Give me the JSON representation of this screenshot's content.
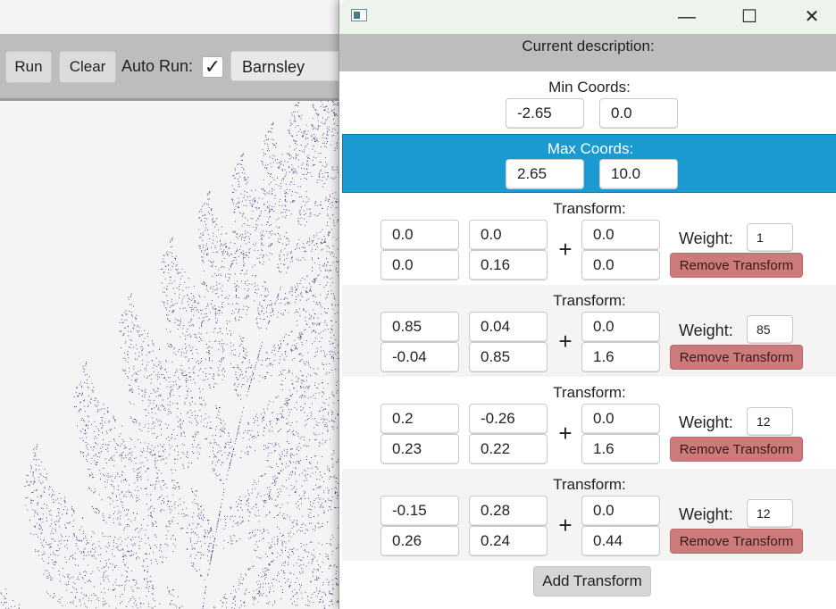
{
  "main_window": {
    "toolbar": {
      "run_label": "Run",
      "clear_label": "Clear",
      "auto_run_label": "Auto Run:",
      "auto_run_checked_glyph": "✓",
      "fractal_selected": "Barnsley"
    },
    "fractal_color": "#2f2a7a"
  },
  "popup": {
    "title_icon": "app-icon",
    "window_controls": {
      "minimize": "—",
      "maximize": "☐",
      "close": "✕"
    },
    "current_description_label": "Current description:",
    "min_coords": {
      "label": "Min Coords:",
      "x": "-2.65",
      "y": "0.0"
    },
    "max_coords": {
      "label": "Max Coords:",
      "x": "2.65",
      "y": "10.0"
    },
    "transform_label": "Transform:",
    "weight_label": "Weight:",
    "remove_label": "Remove Transform",
    "plus_sign": "+",
    "transforms": [
      {
        "a": "0.0",
        "b": "0.0",
        "c": "0.0",
        "d": "0.16",
        "e": "0.0",
        "f": "0.0",
        "weight": "1"
      },
      {
        "a": "0.85",
        "b": "0.04",
        "c": "-0.04",
        "d": "0.85",
        "e": "0.0",
        "f": "1.6",
        "weight": "85"
      },
      {
        "a": "0.2",
        "b": "-0.26",
        "c": "0.23",
        "d": "0.22",
        "e": "0.0",
        "f": "1.6",
        "weight": "12"
      },
      {
        "a": "-0.15",
        "b": "0.28",
        "c": "0.26",
        "d": "0.24",
        "e": "0.0",
        "f": "0.44",
        "weight": "12"
      }
    ],
    "add_transform_label": "Add Transform",
    "colors": {
      "highlight": "#1a9ad0",
      "remove": "#cc7a7a"
    }
  }
}
